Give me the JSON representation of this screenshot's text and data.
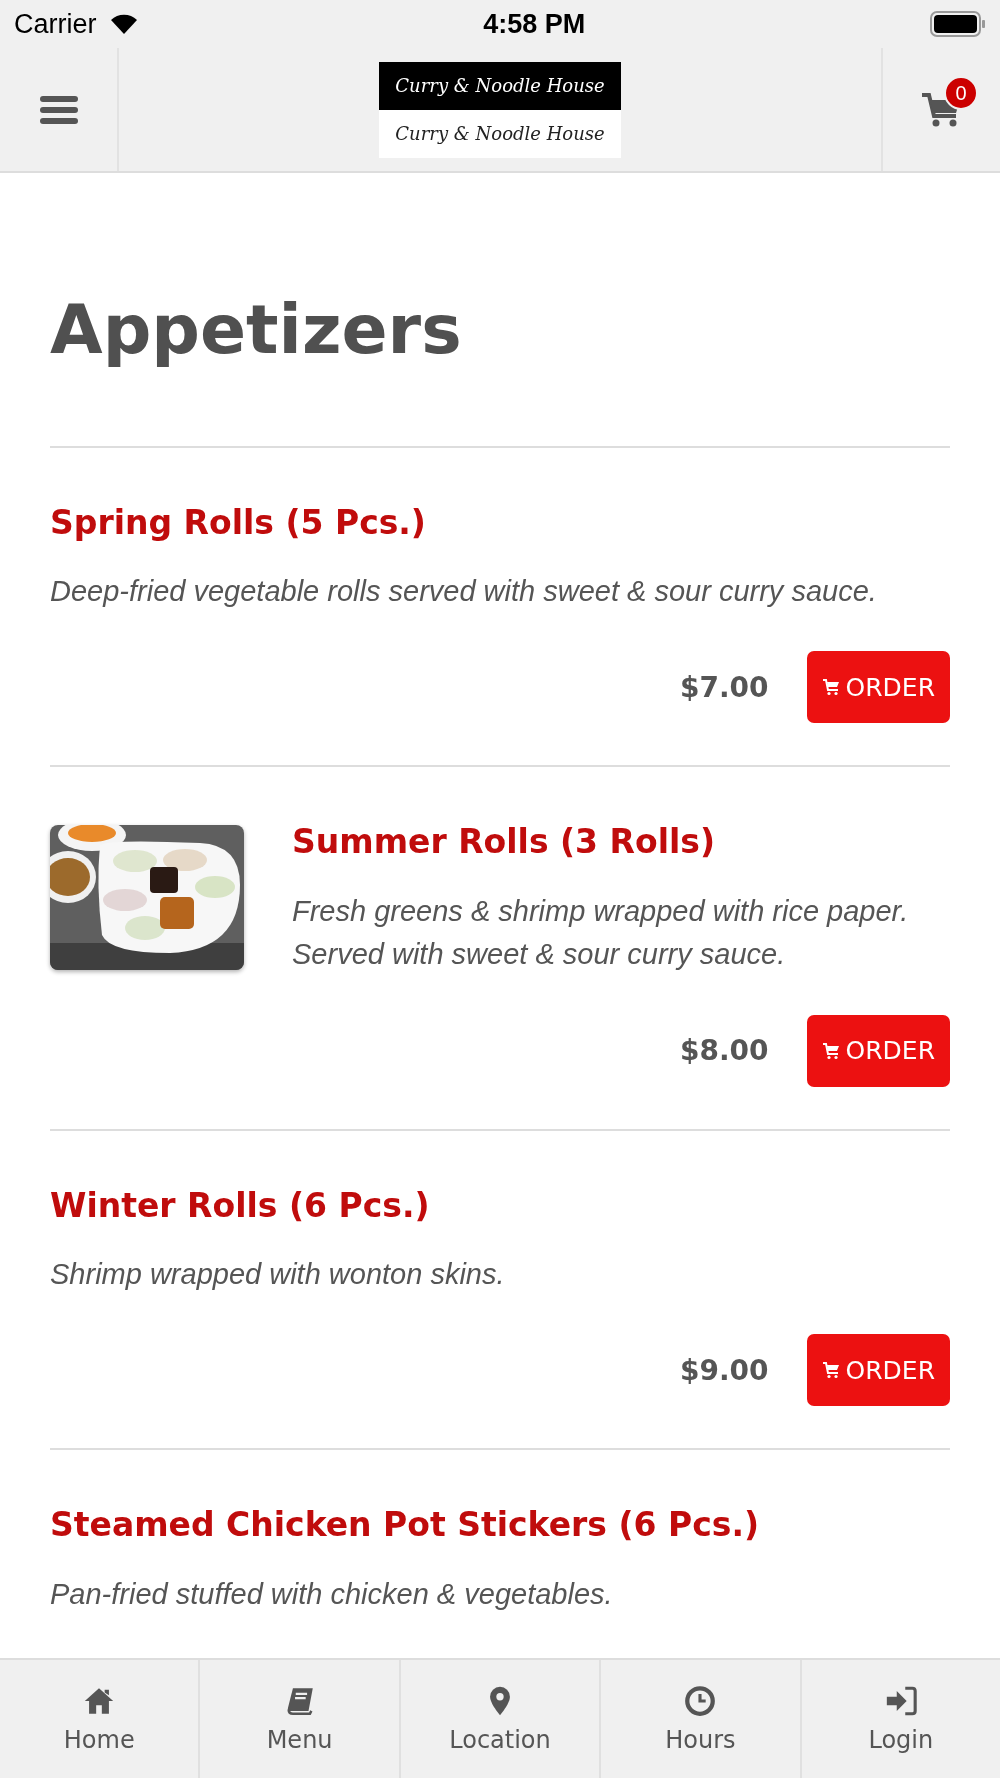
{
  "status_bar": {
    "carrier": "Carrier",
    "time": "4:58 PM"
  },
  "header": {
    "logo_lines": [
      "Curry & Noodle House",
      "Curry & Noodle House"
    ],
    "cart_count": "0"
  },
  "section_title": "Appetizers",
  "items": [
    {
      "kind": "plain",
      "name": "Spring Rolls (5 Pcs.)",
      "description": "Deep-fried vegetable rolls served with sweet & sour curry sauce.",
      "price": "$7.00",
      "order_label": "ORDER"
    },
    {
      "name": "Summer Rolls (3 Rolls)",
      "description": "Fresh greens & shrimp wrapped with rice paper. Served with sweet & sour curry sauce.",
      "price": "$8.00",
      "order_label": "ORDER"
    },
    {
      "kind": "plain",
      "name": "Winter Rolls (6 Pcs.)",
      "description": "Shrimp wrapped with wonton skins.",
      "price": "$9.00",
      "order_label": "ORDER"
    },
    {
      "kind": "plain",
      "name": "Steamed Chicken Pot Stickers (6 Pcs.)",
      "description": "Pan-fried stuffed with chicken & vegetables."
    }
  ],
  "tab_bar": [
    {
      "label": "Home"
    },
    {
      "label": "Menu"
    },
    {
      "label": "Location"
    },
    {
      "label": "Hours"
    },
    {
      "label": "Login"
    }
  ]
}
